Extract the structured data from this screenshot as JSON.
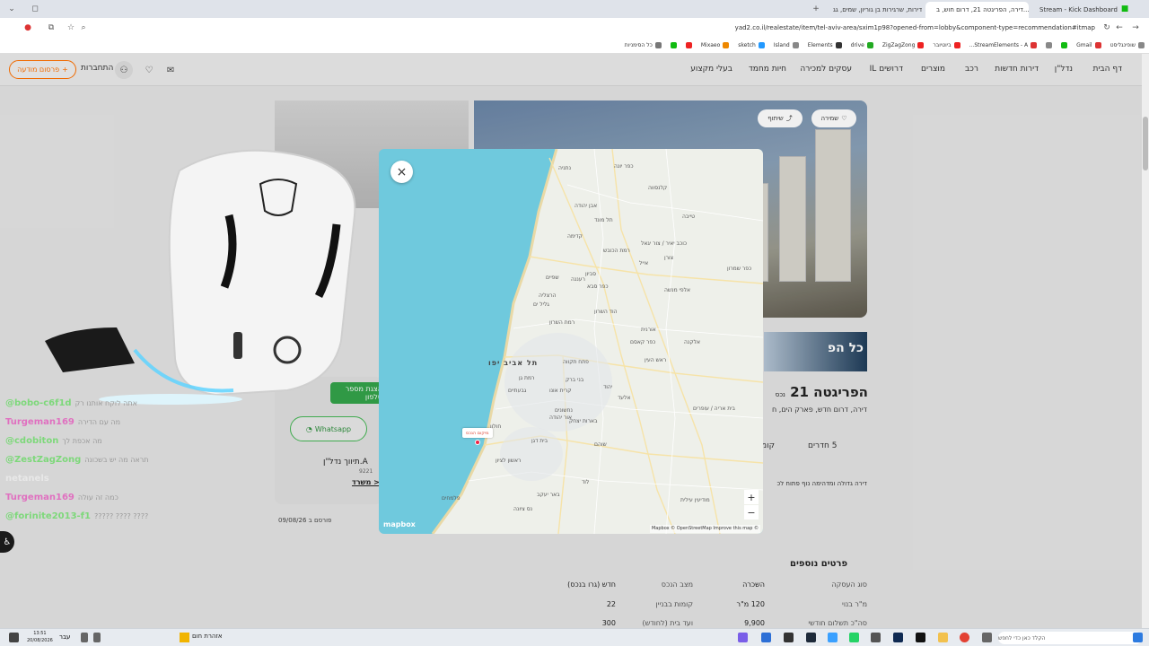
{
  "browser": {
    "tabs": [
      {
        "label": "Stream - Kick Dashboard",
        "icon": "kick-icon"
      },
      {
        "label": "דירה, הפריגטה 21, דרום חוש, ב...",
        "icon": "yad2-icon"
      },
      {
        "label": "דירות, שרגירות בן גוריון, שמים, גג",
        "icon": "yad2-icon"
      }
    ],
    "url": "yad2.co.il/realestate/item/tel-aviv-area/sxim1p98?opened-from=lobby&component-type=recommendation#itmap",
    "bookmarks": [
      "שופינגליסט",
      "Gmail",
      "StreamElements - A...",
      "ביוטיובר",
      "ZigZagZong",
      "drive",
      "Elements",
      "Island",
      "sketch",
      "Mixaeo",
      "כל הסימניות"
    ]
  },
  "site": {
    "nav": [
      "דף הבית",
      "נדל\"ן",
      "דירות חדשות",
      "רכב",
      "מוצרים",
      "דרושים IL",
      "עסקים למכירה",
      "חיות מחמד",
      "בעלי מקצוע"
    ],
    "post_ad": "פרסום מודעה",
    "connect": "התחברות",
    "save_label": "שמירה",
    "share_label": "שיתוף",
    "banner_text": "כל הפ",
    "listing": {
      "title": "הפריגטה 21",
      "badge": "נכס",
      "subtitle": "דירה, דרום חדש, פארק הים, ח",
      "rooms": "5 חדרים",
      "floor": "קומ",
      "description": "דירה גדולה ומדהימה נוף פתוח לכ",
      "location_tag": "מפ"
    },
    "contact": {
      "show_phone": "הצגת מספר טלפון",
      "whatsapp": "Whatsapp",
      "agency": "A.תיווך נדל\"ן",
      "agency_num": "9221",
      "agency_link": "< משרד",
      "published": "פורסם ב 09/08/26"
    },
    "details": {
      "heading": "פרטים נוספים",
      "rows": [
        {
          "label": "סוג העסקה",
          "value": "השכרה",
          "label2": "מצב הנכס",
          "value2": "חדש (גרו בנכס)"
        },
        {
          "label": "מ\"ר בנוי",
          "value": "120 מ\"ר",
          "label2": "קומות בבניין",
          "value2": "22"
        },
        {
          "label": "סה\"כ תשלום חודשי",
          "value": "9,900",
          "label2": "ועד בית (לחודש)",
          "value2": "300"
        }
      ]
    }
  },
  "map": {
    "close_label": "×",
    "pin_label": "מיקום הנכס",
    "zoom_in": "+",
    "zoom_out": "−",
    "logo": "mapbox",
    "attribution": "Mapbox © OpenStreetMap  Improve this map ©",
    "big_city": "תל אביב יפו",
    "towns": [
      "נתניה",
      "כפר יונה",
      "קלנסווה",
      "אבן יהודה",
      "טייבה",
      "תל מונד",
      "כוכב יאיר / צור יגאל",
      "קדימה",
      "צורן",
      "רמת הכובש",
      "אייל",
      "שפיים",
      "כפר סבא",
      "רעננה",
      "הרצליה",
      "גליל ים",
      "אלפי מנשה",
      "הוד השרון",
      "רמת השרון",
      "כפר קאסם",
      "אורנית",
      "אלקנה",
      "פתח תקווה",
      "ראש העין",
      "רמת גן",
      "בני ברק",
      "קרית אונו",
      "יהוד",
      "אלעד",
      "גבעתיים",
      "נחשונים",
      "אור יהודה",
      "בארות יצחק",
      "בית אריה / עופרים",
      "חולון",
      "בית דגן",
      "ראשון לציון",
      "שוהם",
      "לוד",
      "באר יעקב",
      "נס ציונה",
      "פלמחים",
      "מודיעין עילית",
      "כפר שמרון",
      "סביון"
    ]
  },
  "stream": {
    "chat": [
      {
        "user": "@bobo-c6f1d",
        "msg": "אתה לוקח אותנו רק",
        "color": "#7dd87a"
      },
      {
        "user": "Turgeman169",
        "msg": "מה עם הדירה",
        "color": "#e070c0"
      },
      {
        "user": "@cdobiton",
        "msg": "מה אכפת לך",
        "color": "#7dd87a"
      },
      {
        "user": "@ZestZagZong",
        "msg": "תראה מה יש בשכונה",
        "color": "#7dd87a"
      },
      {
        "user": "netanels",
        "msg": "",
        "color": "#e8e8e8"
      },
      {
        "user": "Turgeman169",
        "msg": "כמה זה עולה",
        "color": "#e070c0"
      },
      {
        "user": "@forinite2013-f1",
        "msg": "????? ???? ????",
        "color": "#7dd87a"
      }
    ]
  },
  "taskbar": {
    "time": "13:51",
    "date": "20/08/2026",
    "lang": "עבר",
    "weather": "אזהרת חום",
    "search_placeholder": "הקלד כאן כדי לחפש"
  }
}
